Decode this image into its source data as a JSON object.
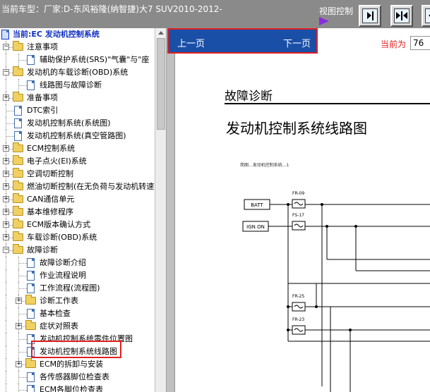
{
  "topbar": {
    "car_title": "当前车型：厂家:D-东风裕隆(纳智捷)大7 SUV2010-2012-",
    "view_control_label": "视图控制",
    "view_buttons": [
      "arrow-right-icon",
      "expand-horizontal-icon",
      "arrow-left-icon"
    ]
  },
  "tree": {
    "root_label": "当前:EC 发动机控制系统",
    "items": [
      {
        "label": "注意事项",
        "type": "folder",
        "indent": 0,
        "expanded": true
      },
      {
        "label": "辅助保护系统(SRS)\"气囊\"与\"座",
        "type": "doc",
        "indent": 1
      },
      {
        "label": "发动机的车载诊断(OBD)系统",
        "type": "folder",
        "indent": 0,
        "expanded": true
      },
      {
        "label": "线路图与故障诊断",
        "type": "doc",
        "indent": 1
      },
      {
        "label": "准备事项",
        "type": "folder",
        "indent": 0,
        "expanded": false
      },
      {
        "label": "DTC索引",
        "type": "doc",
        "indent": 0
      },
      {
        "label": "发动机控制系统(系统图)",
        "type": "doc",
        "indent": 0
      },
      {
        "label": "发动机控制系统(真空管路图)",
        "type": "doc",
        "indent": 0
      },
      {
        "label": "ECM控制系统",
        "type": "folder",
        "indent": 0,
        "expanded": false
      },
      {
        "label": "电子点火(EI)系统",
        "type": "folder",
        "indent": 0,
        "expanded": false
      },
      {
        "label": "空调切断控制",
        "type": "folder",
        "indent": 0,
        "expanded": false
      },
      {
        "label": "燃油切断控制(在无负荷与发动机转速高",
        "type": "folder",
        "indent": 0,
        "expanded": false
      },
      {
        "label": "CAN通信单元",
        "type": "folder",
        "indent": 0,
        "expanded": false
      },
      {
        "label": "基本维修程序",
        "type": "folder",
        "indent": 0,
        "expanded": false
      },
      {
        "label": "ECM版本确认方式",
        "type": "folder",
        "indent": 0,
        "expanded": false
      },
      {
        "label": "车载诊断(OBD)系统",
        "type": "folder",
        "indent": 0,
        "expanded": false
      },
      {
        "label": "故障诊断",
        "type": "folder",
        "indent": 0,
        "expanded": true
      },
      {
        "label": "故障诊断介绍",
        "type": "doc",
        "indent": 1
      },
      {
        "label": "作业流程说明",
        "type": "doc",
        "indent": 1
      },
      {
        "label": "工作流程(流程图)",
        "type": "doc",
        "indent": 1
      },
      {
        "label": "诊断工作表",
        "type": "folder",
        "indent": 1,
        "expanded": false
      },
      {
        "label": "基本检查",
        "type": "doc",
        "indent": 1
      },
      {
        "label": "症状对照表",
        "type": "folder",
        "indent": 1,
        "expanded": false
      },
      {
        "label": "发动机控制系统零件位置图",
        "type": "doc",
        "indent": 1
      },
      {
        "label": "发动机控制系统线路图",
        "type": "doc",
        "indent": 1,
        "selected": true
      },
      {
        "label": "ECM的拆卸与安装",
        "type": "folder",
        "indent": 1,
        "expanded": false
      },
      {
        "label": "各传感器脚位检查表",
        "type": "doc",
        "indent": 1
      },
      {
        "label": "ECM各脚位检查表",
        "type": "doc",
        "indent": 1
      }
    ]
  },
  "nav": {
    "prev_label": "上一页",
    "next_label": "下一页",
    "page_label": "当前为",
    "page_value": "76"
  },
  "document": {
    "section_title": "故障诊断",
    "title": "发动机控制系统线路图",
    "subtitle": "简图...发动机控制系统...1",
    "diagram": {
      "inputs": [
        "BATT",
        "IGN ON"
      ],
      "fuses": [
        "FR-09",
        "FS-17",
        "FR-25",
        "FR-23"
      ]
    }
  },
  "colors": {
    "nav_blue": "#1a4fa8",
    "highlight_red": "#e02020",
    "topbar_gray": "#8a8a8a",
    "root_blue": "#1030c0"
  }
}
